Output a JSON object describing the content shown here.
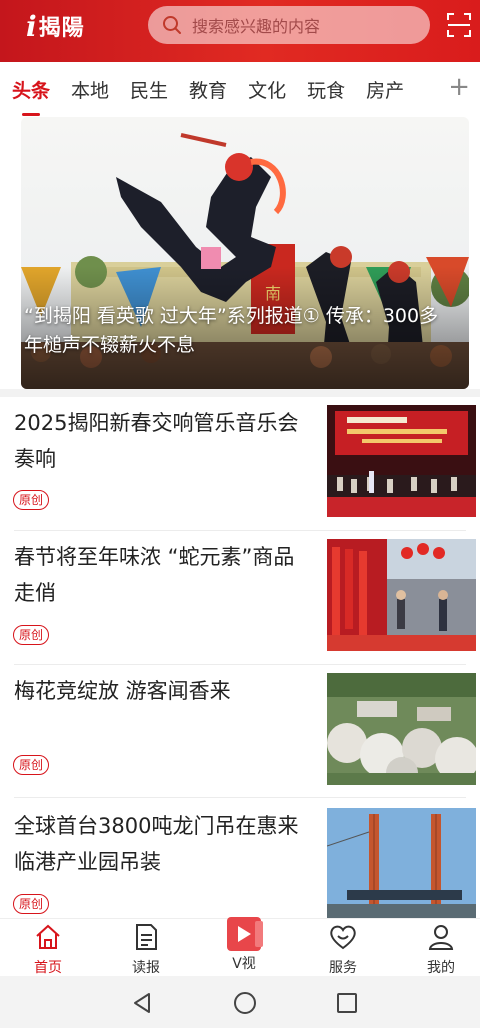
{
  "header": {
    "logo_i": "i",
    "logo_name": "揭陽",
    "search_placeholder": "搜索感兴趣的内容"
  },
  "tabs": [
    "头条",
    "本地",
    "民生",
    "教育",
    "文化",
    "玩食",
    "房产"
  ],
  "tab_more": "+",
  "hero": {
    "caption": "“到揭阳 看英歌 过大年”系列报道① 传承：300多年槌声不辍薪火不息",
    "banner_text": "南"
  },
  "articles": [
    {
      "title": "2025揭阳新春交响管乐音乐会奏响",
      "tag": "原创"
    },
    {
      "title": "春节将至年味浓 “蛇元素”商品走俏",
      "tag": "原创"
    },
    {
      "title": "梅花竞绽放  游客闻香来",
      "tag": "原创"
    },
    {
      "title": "全球首台3800吨龙门吊在惠来临港产业园吊装",
      "tag": "原创"
    }
  ],
  "bottom_nav": [
    {
      "label": "首页",
      "icon": "home-icon"
    },
    {
      "label": "读报",
      "icon": "newspaper-icon"
    },
    {
      "label": "V视",
      "icon": "video-play-icon"
    },
    {
      "label": "服务",
      "icon": "service-heart-icon"
    },
    {
      "label": "我的",
      "icon": "user-icon"
    }
  ],
  "colors": {
    "brand_red": "#d7141b",
    "header_red": "#e12a22"
  }
}
